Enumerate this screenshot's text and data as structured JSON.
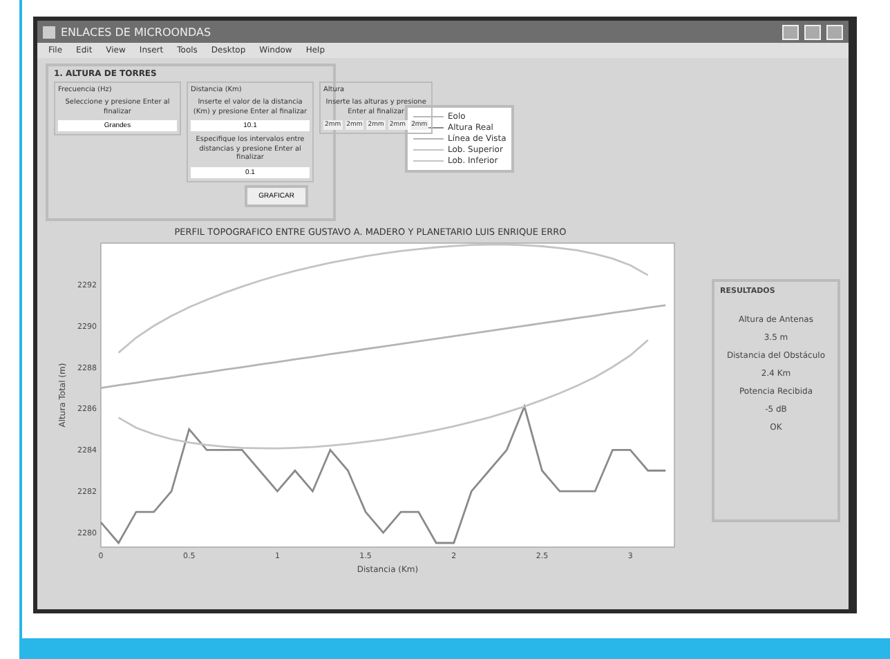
{
  "window": {
    "title": "ENLACES DE MICROONDAS"
  },
  "menu": [
    "File",
    "Edit",
    "View",
    "Insert",
    "Tools",
    "Desktop",
    "Window",
    "Help"
  ],
  "panel": {
    "title": "1. ALTURA DE TORRES",
    "groups": [
      {
        "title": "Frecuencia (Hz)",
        "blocks": [
          {
            "text": "Seleccione y presione Enter al finalizar",
            "value": "Grandes"
          }
        ]
      },
      {
        "title": "Distancia (Km)",
        "blocks": [
          {
            "text": "Inserte el valor de la distancia (Km) y presione Enter al finalizar",
            "value": "10.1"
          },
          {
            "text": "Especifique los intervalos entre distancias y presione Enter al finalizar",
            "value": "0.1"
          }
        ]
      },
      {
        "title": "Altura",
        "blocks": [
          {
            "text": "Inserte las alturas y presione Enter al finalizar",
            "values": [
              "2mm",
              "2mm",
              "2mm",
              "2mm",
              "2mm"
            ]
          }
        ]
      }
    ],
    "button": "GRAFICAR"
  },
  "legend": [
    {
      "label": "Eolo",
      "color": "#b8b8b8"
    },
    {
      "kind": "series"
    },
    {
      "kind": "series"
    },
    {
      "kind": "series"
    },
    {
      "kind": "series"
    }
  ],
  "chart_data": {
    "type": "line",
    "title": "PERFIL TOPOGRAFICO ENTRE GUSTAVO A. MADERO Y PLANETARIO LUIS ENRIQUE ERRO",
    "xlabel": "Distancia (Km)",
    "ylabel": "Altura Total (m)",
    "x": [
      0,
      0.1,
      0.2,
      0.3,
      0.4,
      0.5,
      0.6,
      0.7,
      0.8,
      0.9,
      1.0,
      1.1,
      1.2,
      1.3,
      1.4,
      1.5,
      1.6,
      1.7,
      1.8,
      1.9,
      2.0,
      2.1,
      2.2,
      2.3,
      2.4,
      2.5,
      2.6,
      2.7,
      2.8,
      2.9,
      3.0,
      3.1,
      3.2
    ],
    "series": [
      {
        "name": "Altura Real",
        "color": "#8a8a8a",
        "values": [
          2280.5,
          2279.5,
          2281,
          2281,
          2282,
          2285,
          2284,
          2284,
          2284,
          2283,
          2282,
          2283,
          2282,
          2284,
          2283,
          2281,
          2280,
          2281,
          2281,
          2279.5,
          2279.5,
          2282,
          2283,
          2284,
          2286.1,
          2283,
          2282,
          2282,
          2282,
          2284,
          2284,
          2283,
          2283
        ]
      },
      {
        "name": "Línea de Vista",
        "color": "#b4b4b4",
        "values": [
          2287,
          2287.13,
          2287.25,
          2287.38,
          2287.5,
          2287.63,
          2287.75,
          2287.88,
          2288,
          2288.13,
          2288.25,
          2288.38,
          2288.5,
          2288.63,
          2288.75,
          2288.88,
          2289,
          2289.13,
          2289.25,
          2289.38,
          2289.5,
          2289.63,
          2289.75,
          2289.88,
          2290,
          2290.13,
          2290.25,
          2290.38,
          2290.5,
          2290.63,
          2290.75,
          2290.88,
          2291
        ]
      },
      {
        "name": "Lob. Superior",
        "color": "#c4c4c4",
        "values": [
          null,
          2288.7,
          2289.43,
          2290,
          2290.48,
          2290.9,
          2291.26,
          2291.6,
          2291.9,
          2292.18,
          2292.43,
          2292.66,
          2292.86,
          2293.05,
          2293.21,
          2293.37,
          2293.5,
          2293.62,
          2293.71,
          2293.8,
          2293.86,
          2293.91,
          2293.93,
          2293.93,
          2293.9,
          2293.85,
          2293.76,
          2293.65,
          2293.48,
          2293.25,
          2292.93,
          2292.45,
          null
        ]
      },
      {
        "name": "Lob. Inferior",
        "color": "#c4c4c4",
        "values": [
          null,
          2285.56,
          2285.07,
          2284.76,
          2284.52,
          2284.36,
          2284.24,
          2284.16,
          2284.1,
          2284.08,
          2284.07,
          2284.1,
          2284.14,
          2284.21,
          2284.29,
          2284.39,
          2284.5,
          2284.64,
          2284.79,
          2284.96,
          2285.14,
          2285.35,
          2285.57,
          2285.83,
          2286.1,
          2286.41,
          2286.74,
          2287.11,
          2287.52,
          2288.01,
          2288.57,
          2289.31,
          null
        ]
      }
    ],
    "xlim": [
      0,
      3.25
    ],
    "ylim": [
      2279.3,
      2294
    ],
    "xticks": [
      0,
      0.5,
      1,
      1.5,
      2,
      2.5,
      3
    ],
    "yticks": [
      2280,
      2282,
      2284,
      2286,
      2288,
      2290,
      2292
    ]
  },
  "results": {
    "title": "RESULTADOS",
    "lines": [
      "Altura de Antenas",
      "3.5 m",
      "Distancia del Obstáculo",
      "2.4 Km",
      "Potencia Recibida",
      "-5 dB",
      "OK"
    ]
  }
}
